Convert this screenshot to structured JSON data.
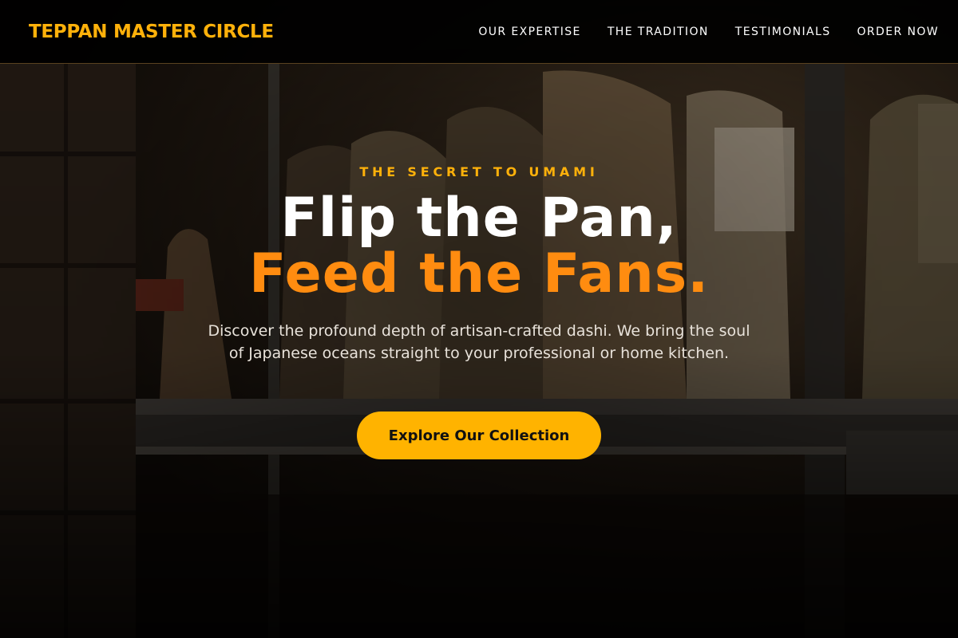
{
  "header": {
    "brand": "TEPPAN MASTER CIRCLE",
    "nav": [
      {
        "label": "OUR EXPERTISE"
      },
      {
        "label": "THE TRADITION"
      },
      {
        "label": "TESTIMONIALS"
      },
      {
        "label": "ORDER NOW"
      }
    ]
  },
  "hero": {
    "eyebrow": "THE SECRET TO UMAMI",
    "headline_line1": "Flip the Pan,",
    "headline_line2": "Feed the Fans.",
    "lead": "Discover the profound depth of artisan-crafted dashi. We bring the soul of Japanese oceans straight to your professional or home kitchen.",
    "cta_label": "Explore Our Collection"
  },
  "theme": {
    "accent": "#ffb10a",
    "headline_accent": "#ff8c10",
    "header_bg": "#000000",
    "text": "#ffffff"
  },
  "background": {
    "icon": "pantry-shelves-photo"
  }
}
